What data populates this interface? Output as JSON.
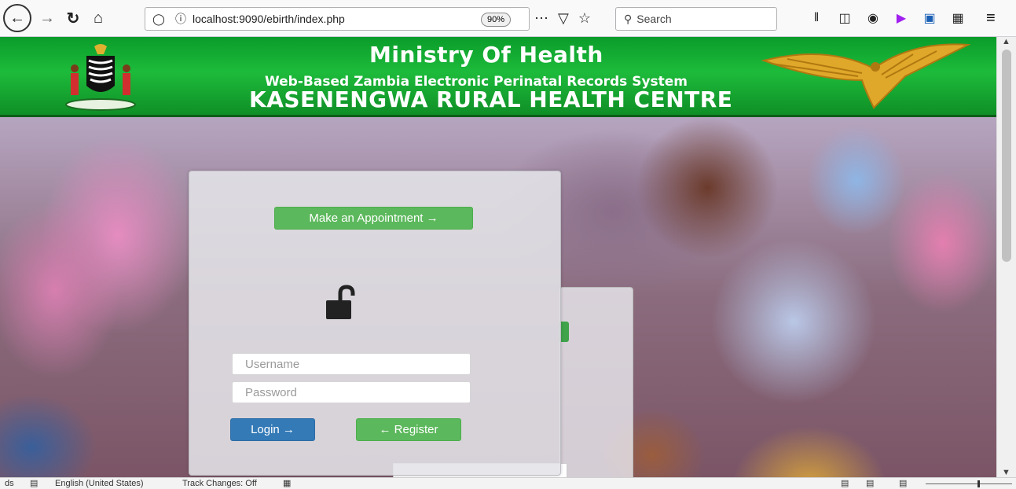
{
  "browser": {
    "back_icon": "arrow-left-icon",
    "forward_icon": "arrow-right-icon",
    "reload_icon": "reload-icon",
    "home_icon": "home-icon",
    "url": "localhost:9090/ebirth/index.php",
    "zoom": "90%",
    "search_placeholder": "Search",
    "icons_right": [
      "library-icon",
      "sidebar-icon",
      "account-icon",
      "play-extension-icon",
      "s-extension-icon",
      "grid-extension-icon"
    ]
  },
  "banner": {
    "title": "Ministry Of Health",
    "subtitle": "Web-Based Zambia Electronic Perinatal Records System",
    "facility": "KASENENGWA RURAL HEALTH CENTRE",
    "color_green": "#1dbb3b"
  },
  "login": {
    "appointment_label": "Make an Appointment →",
    "username_placeholder": "Username",
    "password_placeholder": "Password",
    "login_label": "Login →",
    "register_label": "← Register",
    "login_color": "#337ab7",
    "success_color": "#5cb85c"
  },
  "statusbar": {
    "left_fragment": "ds",
    "language": "English (United States)",
    "track_changes": "Track Changes: Off"
  }
}
